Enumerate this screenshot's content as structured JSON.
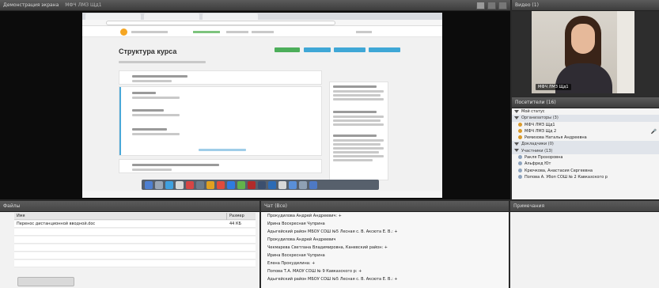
{
  "share": {
    "title": "Демонстрация экрана",
    "presenter": "МФЧ ЛМЗ Щд1"
  },
  "shared_screen": {
    "course_title": "Структура курса"
  },
  "camera": {
    "title": "Видео (1)",
    "name_label": "МФЧ ЛМЗ Щд1"
  },
  "attendees": {
    "title": "Посетители (16)",
    "rows": [
      {
        "kind": "status",
        "text": "Мой статус"
      },
      {
        "kind": "group",
        "text": "Организаторы (3)"
      },
      {
        "kind": "host",
        "text": "МФЧ ЛМЗ Щд1"
      },
      {
        "kind": "host",
        "text": "МФЧ ЛМЗ Щд 2",
        "mic": true
      },
      {
        "kind": "host",
        "text": "Ремизова Наталья Андреевна"
      },
      {
        "kind": "group",
        "text": "Докладчики (0)"
      },
      {
        "kind": "group",
        "text": "Участники (13)"
      },
      {
        "kind": "part",
        "text": "Ракля Прохоровна"
      },
      {
        "kind": "part",
        "text": "Альфред Ют"
      },
      {
        "kind": "part",
        "text": "Крючкова, Анастасия Сергеевна"
      },
      {
        "kind": "part",
        "text": "Попова А. Убоп СОШ № 2 Кавказского р"
      }
    ]
  },
  "files": {
    "title": "Файлы",
    "columns": {
      "name": "Имя",
      "size": "Размер"
    },
    "rows": [
      {
        "name": "Перенос дистанционной вводной.doc",
        "size": "44 КБ"
      }
    ]
  },
  "chat": {
    "title": "Чат (Все)",
    "lines": [
      "Прокудилова Андрей Андреевич: +",
      "Ирина Воскресная Чуприна",
      "Адыгейский район МБОУ СОШ №5 Лесная с. В. Аксюта Е. В.: +",
      "Прокудилова Андрей Андреевич",
      "Чекмарева Светлана Владимировна, Каневский район: +",
      "Ирина Воскресная Чуприна",
      "Елена Прокудилина: +",
      "Попова Т.А. МАОУ СОШ № 9 Кавказского р: +",
      "Адыгейский район МБОУ СОШ №5 Лесная с. В. Аксюта Е. В.: +"
    ]
  },
  "notes": {
    "title": "Примечания"
  }
}
